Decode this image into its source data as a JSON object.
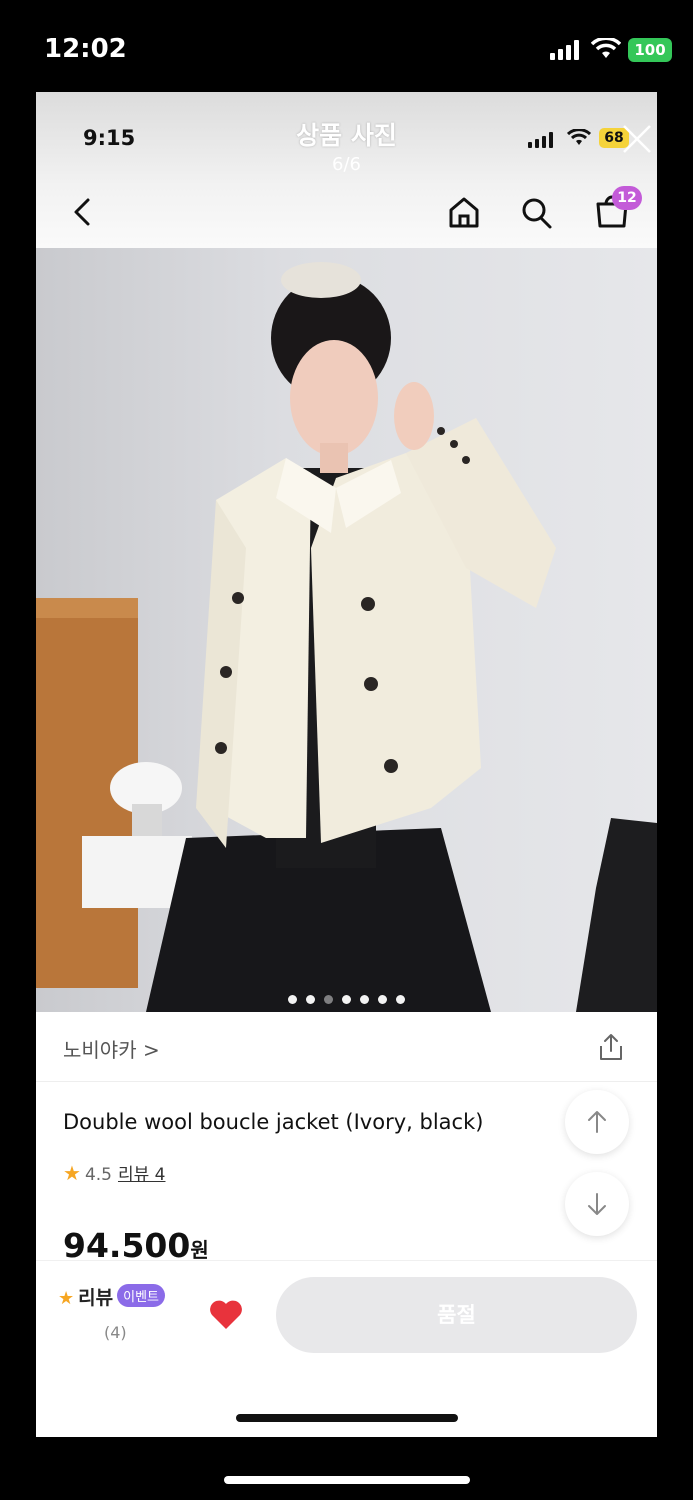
{
  "outer_status": {
    "time": "12:02",
    "battery": "100"
  },
  "inner_status": {
    "time": "9:15",
    "battery": "68"
  },
  "viewer": {
    "title": "상품 사진",
    "counter": "6/6"
  },
  "header": {
    "cart_count": "12"
  },
  "brand": {
    "name": "노비야카 >"
  },
  "product": {
    "title": "Double wool boucle jacket (Ivory, black)",
    "rating": "4.5",
    "review_link": "리뷰 4",
    "price": "94.500",
    "price_unit": "원"
  },
  "bottom_bar": {
    "review_label": "리뷰",
    "event_badge": "이벤트",
    "review_count": "(4)",
    "buy_button": "품절"
  },
  "colors": {
    "accent_purple": "#8b6be8",
    "cart_badge": "#c35bd8",
    "star": "#f6a623",
    "heart": "#e8333c"
  },
  "icons": [
    "back-icon",
    "home-icon",
    "search-icon",
    "cart-icon",
    "close-icon",
    "share-icon",
    "arrow-up-icon",
    "arrow-down-icon",
    "heart-icon",
    "star-icon"
  ]
}
